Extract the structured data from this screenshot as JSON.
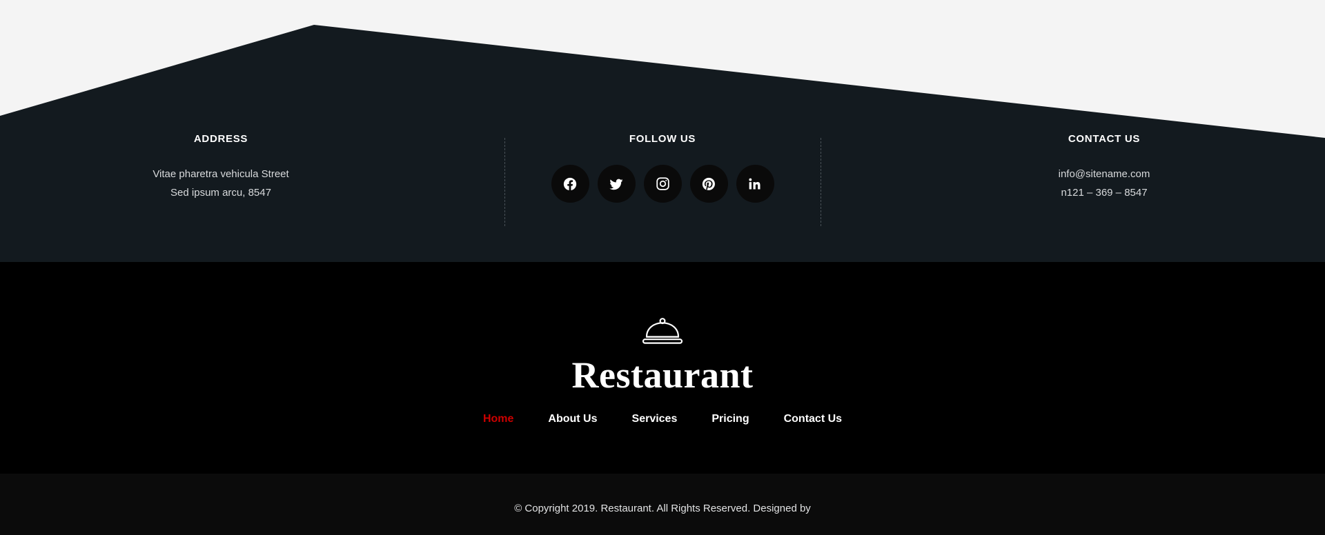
{
  "theme": {
    "page_background": "#f4f4f4",
    "angled_section_background": "#131a1f",
    "brand_section_background": "#000000",
    "copyright_background": "#0b0b0b",
    "accent_red": "#cc0000",
    "text_primary": "#ffffff",
    "text_muted": "#d8dadc",
    "divider_color": "#4a5258",
    "social_button_background": "#0a0a0a"
  },
  "footer": {
    "columns": [
      {
        "title": "ADDRESS",
        "lines": [
          "Vitae pharetra vehicula Street",
          "Sed ipsum arcu, 8547"
        ]
      },
      {
        "title": "FOLLOW US",
        "social": [
          {
            "name": "facebook",
            "label": "Facebook"
          },
          {
            "name": "twitter",
            "label": "Twitter"
          },
          {
            "name": "instagram",
            "label": "Instagram"
          },
          {
            "name": "pinterest",
            "label": "Pinterest"
          },
          {
            "name": "linkedin",
            "label": "LinkedIn"
          }
        ]
      },
      {
        "title": "CONTACT US",
        "lines": [
          "info@sitename.com",
          "n121 – 369 – 8547"
        ]
      }
    ]
  },
  "brand": {
    "logo_icon": "cloche-icon",
    "name": "Restaurant",
    "nav": [
      {
        "label": "Home",
        "active": true
      },
      {
        "label": "About Us",
        "active": false
      },
      {
        "label": "Services",
        "active": false
      },
      {
        "label": "Pricing",
        "active": false
      },
      {
        "label": "Contact Us",
        "active": false
      }
    ]
  },
  "copyright": {
    "text": "© Copyright 2019. Restaurant. All Rights Reserved. Designed by"
  }
}
